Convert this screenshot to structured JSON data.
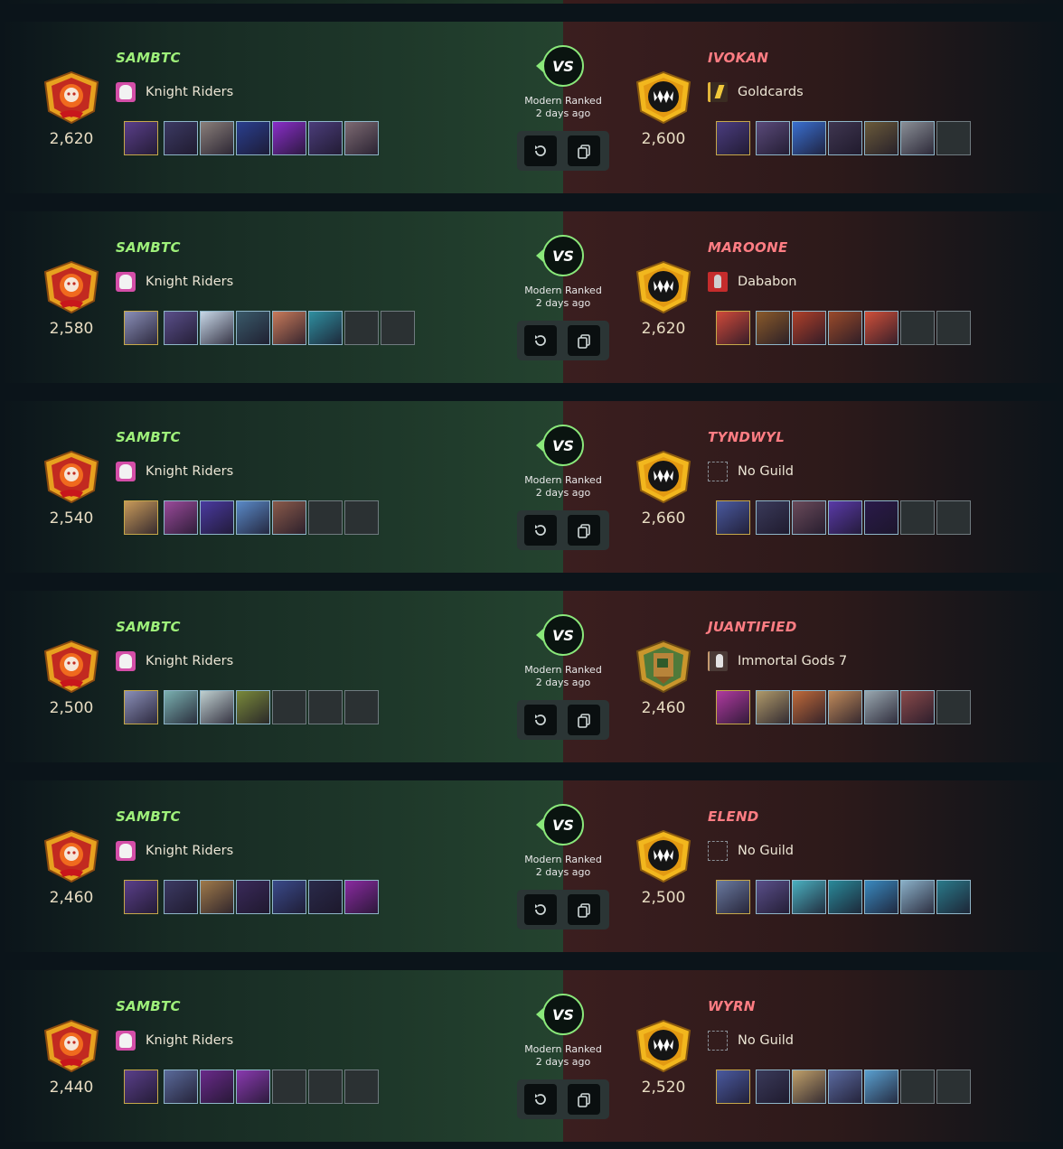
{
  "colors": {
    "player_name_left": "#9ef07a",
    "player_name_right": "#ff7d83",
    "rating": "#e7dcc2",
    "win_bg": "#24432f",
    "loss_bg": "#3b1e1f",
    "vs_border": "#8ae87a",
    "card_border": "#8fb6c9",
    "summoner_border": "#c6a84a"
  },
  "icons": {
    "left_league": "champion-league-emblem-icon",
    "right_league": "diamond-league-emblem-icon",
    "replay": "replay-icon",
    "copy": "copy-icon"
  },
  "battles": [
    {
      "mode": "Modern Ranked",
      "time": "2 days ago",
      "vs": "VS",
      "left": {
        "name": "SAMBTC",
        "rating": "2,620",
        "guild": "Knight Riders",
        "guild_icon": "knight",
        "emblem": "champion",
        "cards": [
          "#5a3f8a",
          "#3c3a63",
          "#8a7f7a",
          "#2a3f8f",
          "#8a2ec9",
          "#4b3d7a",
          "#7d6a72"
        ],
        "empty_slots": 0
      },
      "right": {
        "name": "IVOKAN",
        "rating": "2,600",
        "guild": "Goldcards",
        "guild_icon": "gold",
        "emblem": "diamond",
        "cards": [
          "#4b3d80",
          "#5a4a7a",
          "#3a6fd0",
          "#3f3650",
          "#6a5a3a",
          "#8a8f96"
        ],
        "empty_slots": 1
      }
    },
    {
      "mode": "Modern Ranked",
      "time": "2 days ago",
      "vs": "VS",
      "left": {
        "name": "SAMBTC",
        "rating": "2,580",
        "guild": "Knight Riders",
        "guild_icon": "knight",
        "emblem": "champion",
        "cards": [
          "#8a8fb8",
          "#5a4f8a",
          "#c8d8e8",
          "#3a5a6a",
          "#c87a5a",
          "#2f8fa0"
        ],
        "empty_slots": 2
      },
      "right": {
        "name": "MAROONE",
        "rating": "2,620",
        "guild": "Dababon",
        "guild_icon": "red",
        "emblem": "diamond",
        "cards": [
          "#d04a3a",
          "#8a5a2a",
          "#b0402a",
          "#9a4a2a",
          "#d0503a"
        ],
        "empty_slots": 2
      }
    },
    {
      "mode": "Modern Ranked",
      "time": "2 days ago",
      "vs": "VS",
      "left": {
        "name": "SAMBTC",
        "rating": "2,540",
        "guild": "Knight Riders",
        "guild_icon": "knight",
        "emblem": "champion",
        "cards": [
          "#c89a5a",
          "#9a4a9a",
          "#4a3aa0",
          "#5a8ac8",
          "#8a5a4a"
        ],
        "empty_slots": 2
      },
      "right": {
        "name": "TYNDWYL",
        "rating": "2,660",
        "guild": "No Guild",
        "guild_icon": "none",
        "emblem": "diamond",
        "cards": [
          "#4a5aa0",
          "#3a3a5a",
          "#6a4a5a",
          "#5a3aa8",
          "#2a1a4a"
        ],
        "empty_slots": 2
      }
    },
    {
      "mode": "Modern Ranked",
      "time": "2 days ago",
      "vs": "VS",
      "left": {
        "name": "SAMBTC",
        "rating": "2,500",
        "guild": "Knight Riders",
        "guild_icon": "knight",
        "emblem": "champion",
        "cards": [
          "#8a8fb8",
          "#7ab0b0",
          "#c0d0d0",
          "#7a8a3a"
        ],
        "empty_slots": 3
      },
      "right": {
        "name": "JUANTIFIED",
        "rating": "2,460",
        "guild": "Immortal Gods 7",
        "guild_icon": "immortal",
        "emblem": "rookie",
        "cards": [
          "#b03aa0",
          "#b09a6a",
          "#c06a3a",
          "#c08a5a",
          "#9aa8b0",
          "#8a4a4a"
        ],
        "empty_slots": 1
      }
    },
    {
      "mode": "Modern Ranked",
      "time": "2 days ago",
      "vs": "VS",
      "left": {
        "name": "SAMBTC",
        "rating": "2,460",
        "guild": "Knight Riders",
        "guild_icon": "knight",
        "emblem": "champion",
        "cards": [
          "#5a3f8a",
          "#3c3a63",
          "#a07a4a",
          "#3a2a5a",
          "#3a4a8a",
          "#2a2a4a",
          "#8a2aa0"
        ],
        "empty_slots": 0
      },
      "right": {
        "name": "ELEND",
        "rating": "2,500",
        "guild": "No Guild",
        "guild_icon": "none",
        "emblem": "diamond",
        "cards": [
          "#6a7aa0",
          "#5a4f8a",
          "#4ab0c0",
          "#2a8a9a",
          "#3a8ac0",
          "#8ab0c8",
          "#2a7a8a"
        ],
        "empty_slots": 0
      }
    },
    {
      "mode": "Modern Ranked",
      "time": "2 days ago",
      "vs": "VS",
      "left": {
        "name": "SAMBTC",
        "rating": "2,440",
        "guild": "Knight Riders",
        "guild_icon": "knight",
        "emblem": "champion",
        "cards": [
          "#5a3f8a",
          "#5a6a9a",
          "#6a2a8a",
          "#8a3ab0"
        ],
        "empty_slots": 3
      },
      "right": {
        "name": "WYRN",
        "rating": "2,520",
        "guild": "No Guild",
        "guild_icon": "none",
        "emblem": "diamond",
        "cards": [
          "#4a5aa0",
          "#3a3a5a",
          "#c0a06a",
          "#5a6aa0",
          "#5aa0d0"
        ],
        "empty_slots": 2
      }
    }
  ]
}
